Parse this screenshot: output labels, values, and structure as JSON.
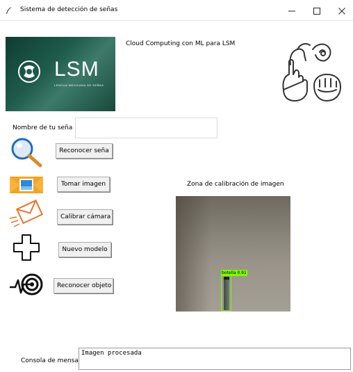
{
  "window": {
    "title": "Sistema de detección de señas",
    "minimize_icon": "minimize-icon",
    "maximize_icon": "maximize-icon",
    "close_icon": "close-icon"
  },
  "header": {
    "logo_text": "LSM",
    "logo_subtitle": "LENGUA MEXICANA DE SEÑAS",
    "caption": "Cloud Computing con ML para LSM",
    "hands_icon": "sign-language-hands-icon"
  },
  "form": {
    "name_label": "Nombre de tu seña",
    "name_value": ""
  },
  "actions": [
    {
      "icon": "magnifier-icon",
      "label": "Reconocer seña"
    },
    {
      "icon": "image-icon",
      "label": "Tomar imagen"
    },
    {
      "icon": "envelope-icon",
      "label": "Calibrar cámara"
    },
    {
      "icon": "plus-icon",
      "label": "Nuevo modelo"
    },
    {
      "icon": "target-icon",
      "label": "Reconocer objeto"
    }
  ],
  "calibration": {
    "label": "Zona de calibración de imagen",
    "detection_label": "botella 0.91",
    "detection_color": "#7cfc00"
  },
  "console": {
    "label": "Consola de mensaj",
    "message": "Imagen procesada"
  }
}
